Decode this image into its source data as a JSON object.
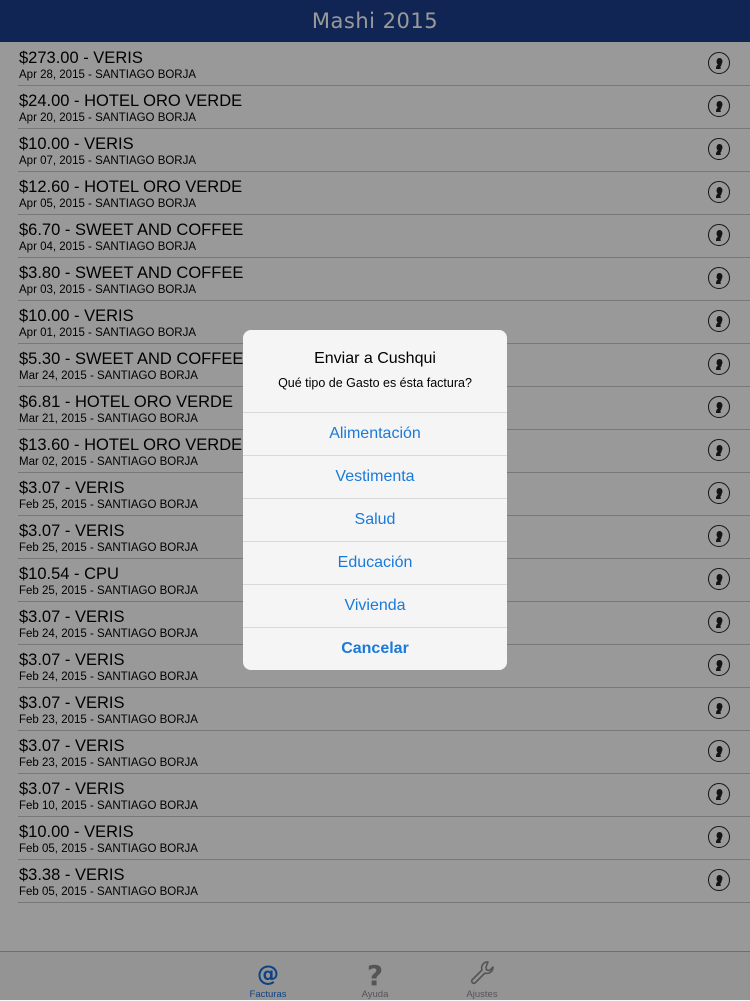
{
  "navbar": {
    "title": "Mashi 2015"
  },
  "invoices": [
    {
      "title": "$273.00 - VERIS",
      "subtitle": "Apr 28,  2015 - SANTIAGO BORJA"
    },
    {
      "title": "$24.00 - HOTEL ORO VERDE",
      "subtitle": "Apr 20,  2015 - SANTIAGO BORJA"
    },
    {
      "title": "$10.00 - VERIS",
      "subtitle": "Apr 07,  2015 - SANTIAGO BORJA"
    },
    {
      "title": "$12.60 - HOTEL ORO VERDE",
      "subtitle": "Apr 05,  2015 - SANTIAGO BORJA"
    },
    {
      "title": "$6.70 - SWEET AND COFFEE",
      "subtitle": "Apr 04,  2015 - SANTIAGO BORJA"
    },
    {
      "title": "$3.80 - SWEET AND COFFEE",
      "subtitle": "Apr 03,  2015 - SANTIAGO BORJA"
    },
    {
      "title": "$10.00 - VERIS",
      "subtitle": "Apr 01,  2015 - SANTIAGO BORJA"
    },
    {
      "title": "$5.30 - SWEET AND COFFEE",
      "subtitle": "Mar 24,  2015 - SANTIAGO BORJA"
    },
    {
      "title": "$6.81 - HOTEL ORO VERDE",
      "subtitle": "Mar 21,  2015 - SANTIAGO BORJA"
    },
    {
      "title": "$13.60 - HOTEL ORO VERDE",
      "subtitle": "Mar 02,  2015 - SANTIAGO BORJA"
    },
    {
      "title": "$3.07 - VERIS",
      "subtitle": "Feb 25,  2015 - SANTIAGO BORJA"
    },
    {
      "title": "$3.07 - VERIS",
      "subtitle": "Feb 25,  2015 - SANTIAGO BORJA"
    },
    {
      "title": "$10.54 - CPU",
      "subtitle": "Feb 25,  2015 - SANTIAGO BORJA"
    },
    {
      "title": "$3.07 - VERIS",
      "subtitle": "Feb 24,  2015 - SANTIAGO BORJA"
    },
    {
      "title": "$3.07 - VERIS",
      "subtitle": "Feb 24,  2015 - SANTIAGO BORJA"
    },
    {
      "title": "$3.07 - VERIS",
      "subtitle": "Feb 23,  2015 - SANTIAGO BORJA"
    },
    {
      "title": "$3.07 - VERIS",
      "subtitle": "Feb 23,  2015 - SANTIAGO BORJA"
    },
    {
      "title": "$3.07 - VERIS",
      "subtitle": "Feb 10,  2015 - SANTIAGO BORJA"
    },
    {
      "title": "$10.00 - VERIS",
      "subtitle": "Feb 05,  2015 - SANTIAGO BORJA"
    },
    {
      "title": "$3.38 - VERIS",
      "subtitle": "Feb 05,  2015 - SANTIAGO BORJA"
    }
  ],
  "row_icon": "person-silhouette-icon",
  "alert": {
    "title": "Enviar a Cushqui",
    "message": "Qué tipo de Gasto es ésta factura?",
    "options": [
      "Alimentación",
      "Vestimenta",
      "Salud",
      "Educación",
      "Vivienda"
    ],
    "cancel": "Cancelar"
  },
  "tabbar": {
    "tabs": [
      {
        "label": "Facturas",
        "icon": "at-sign-icon",
        "active": true
      },
      {
        "label": "Ayuda",
        "icon": "question-mark-icon",
        "active": false
      },
      {
        "label": "Ajustes",
        "icon": "wrench-icon",
        "active": false
      }
    ]
  },
  "colors": {
    "navbar": "#1c3f8c",
    "accent": "#1a7ad9",
    "tab_active": "#1a6fd9",
    "tab_inactive": "#8e8e93"
  }
}
